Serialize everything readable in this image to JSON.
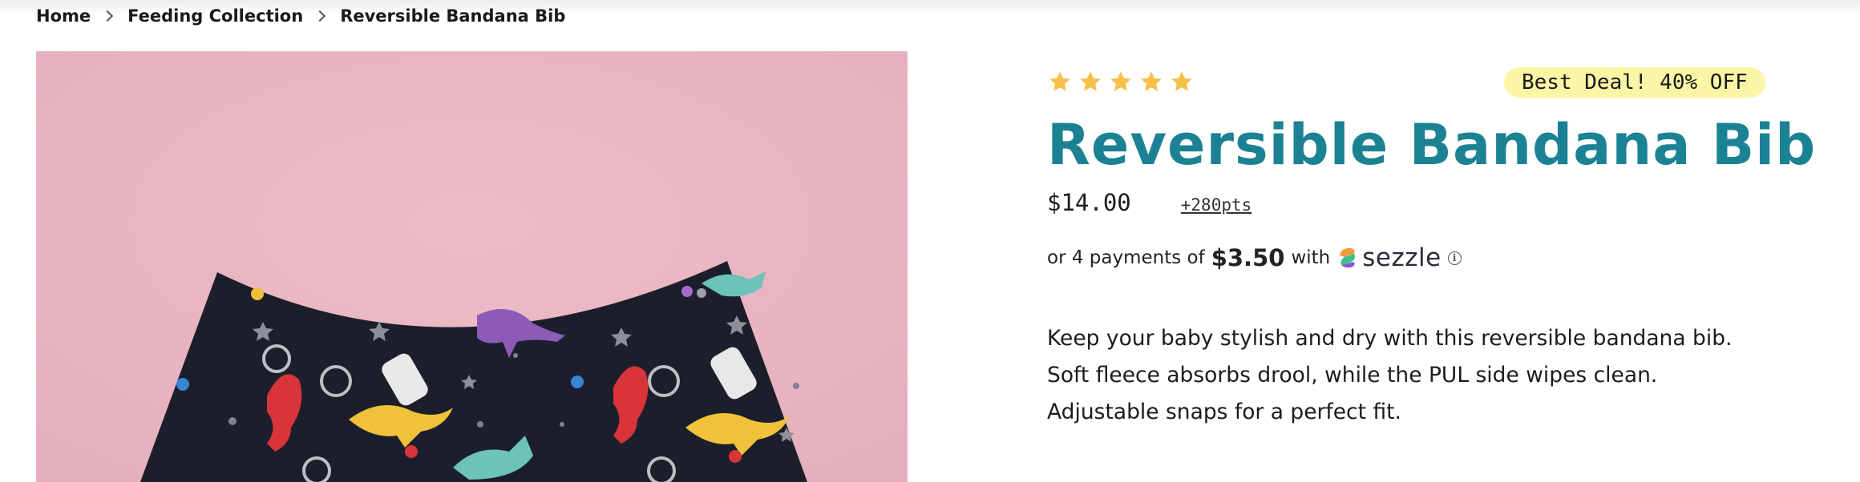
{
  "breadcrumb": {
    "items": [
      "Home",
      "Feeding Collection",
      "Reversible Bandana Bib"
    ]
  },
  "product": {
    "rating": 5,
    "rating_max": 5,
    "badge": "Best Deal! 40% OFF",
    "title": "Reversible Bandana Bib",
    "price": "$14.00",
    "points": "+280pts",
    "installments": {
      "prefix": "or 4 payments of",
      "amount": "$3.50",
      "with": "with",
      "provider": "sezzle"
    },
    "description": [
      "Keep your baby stylish and dry with this reversible bandana bib.",
      "Soft fleece absorbs drool, while the PUL side wipes clean.",
      "Adjustable snaps for a perfect fit."
    ]
  },
  "icons": {
    "star": "star-icon",
    "chevron": "chevron-right-icon",
    "sezzle": "sezzle-logo-icon",
    "info": "info-icon"
  },
  "colors": {
    "title": "#1b8294",
    "star": "#f7c04a",
    "badge_bg": "#fbf5a6",
    "image_bg": "#ecb9c5",
    "bib": "#1d1e2c"
  }
}
